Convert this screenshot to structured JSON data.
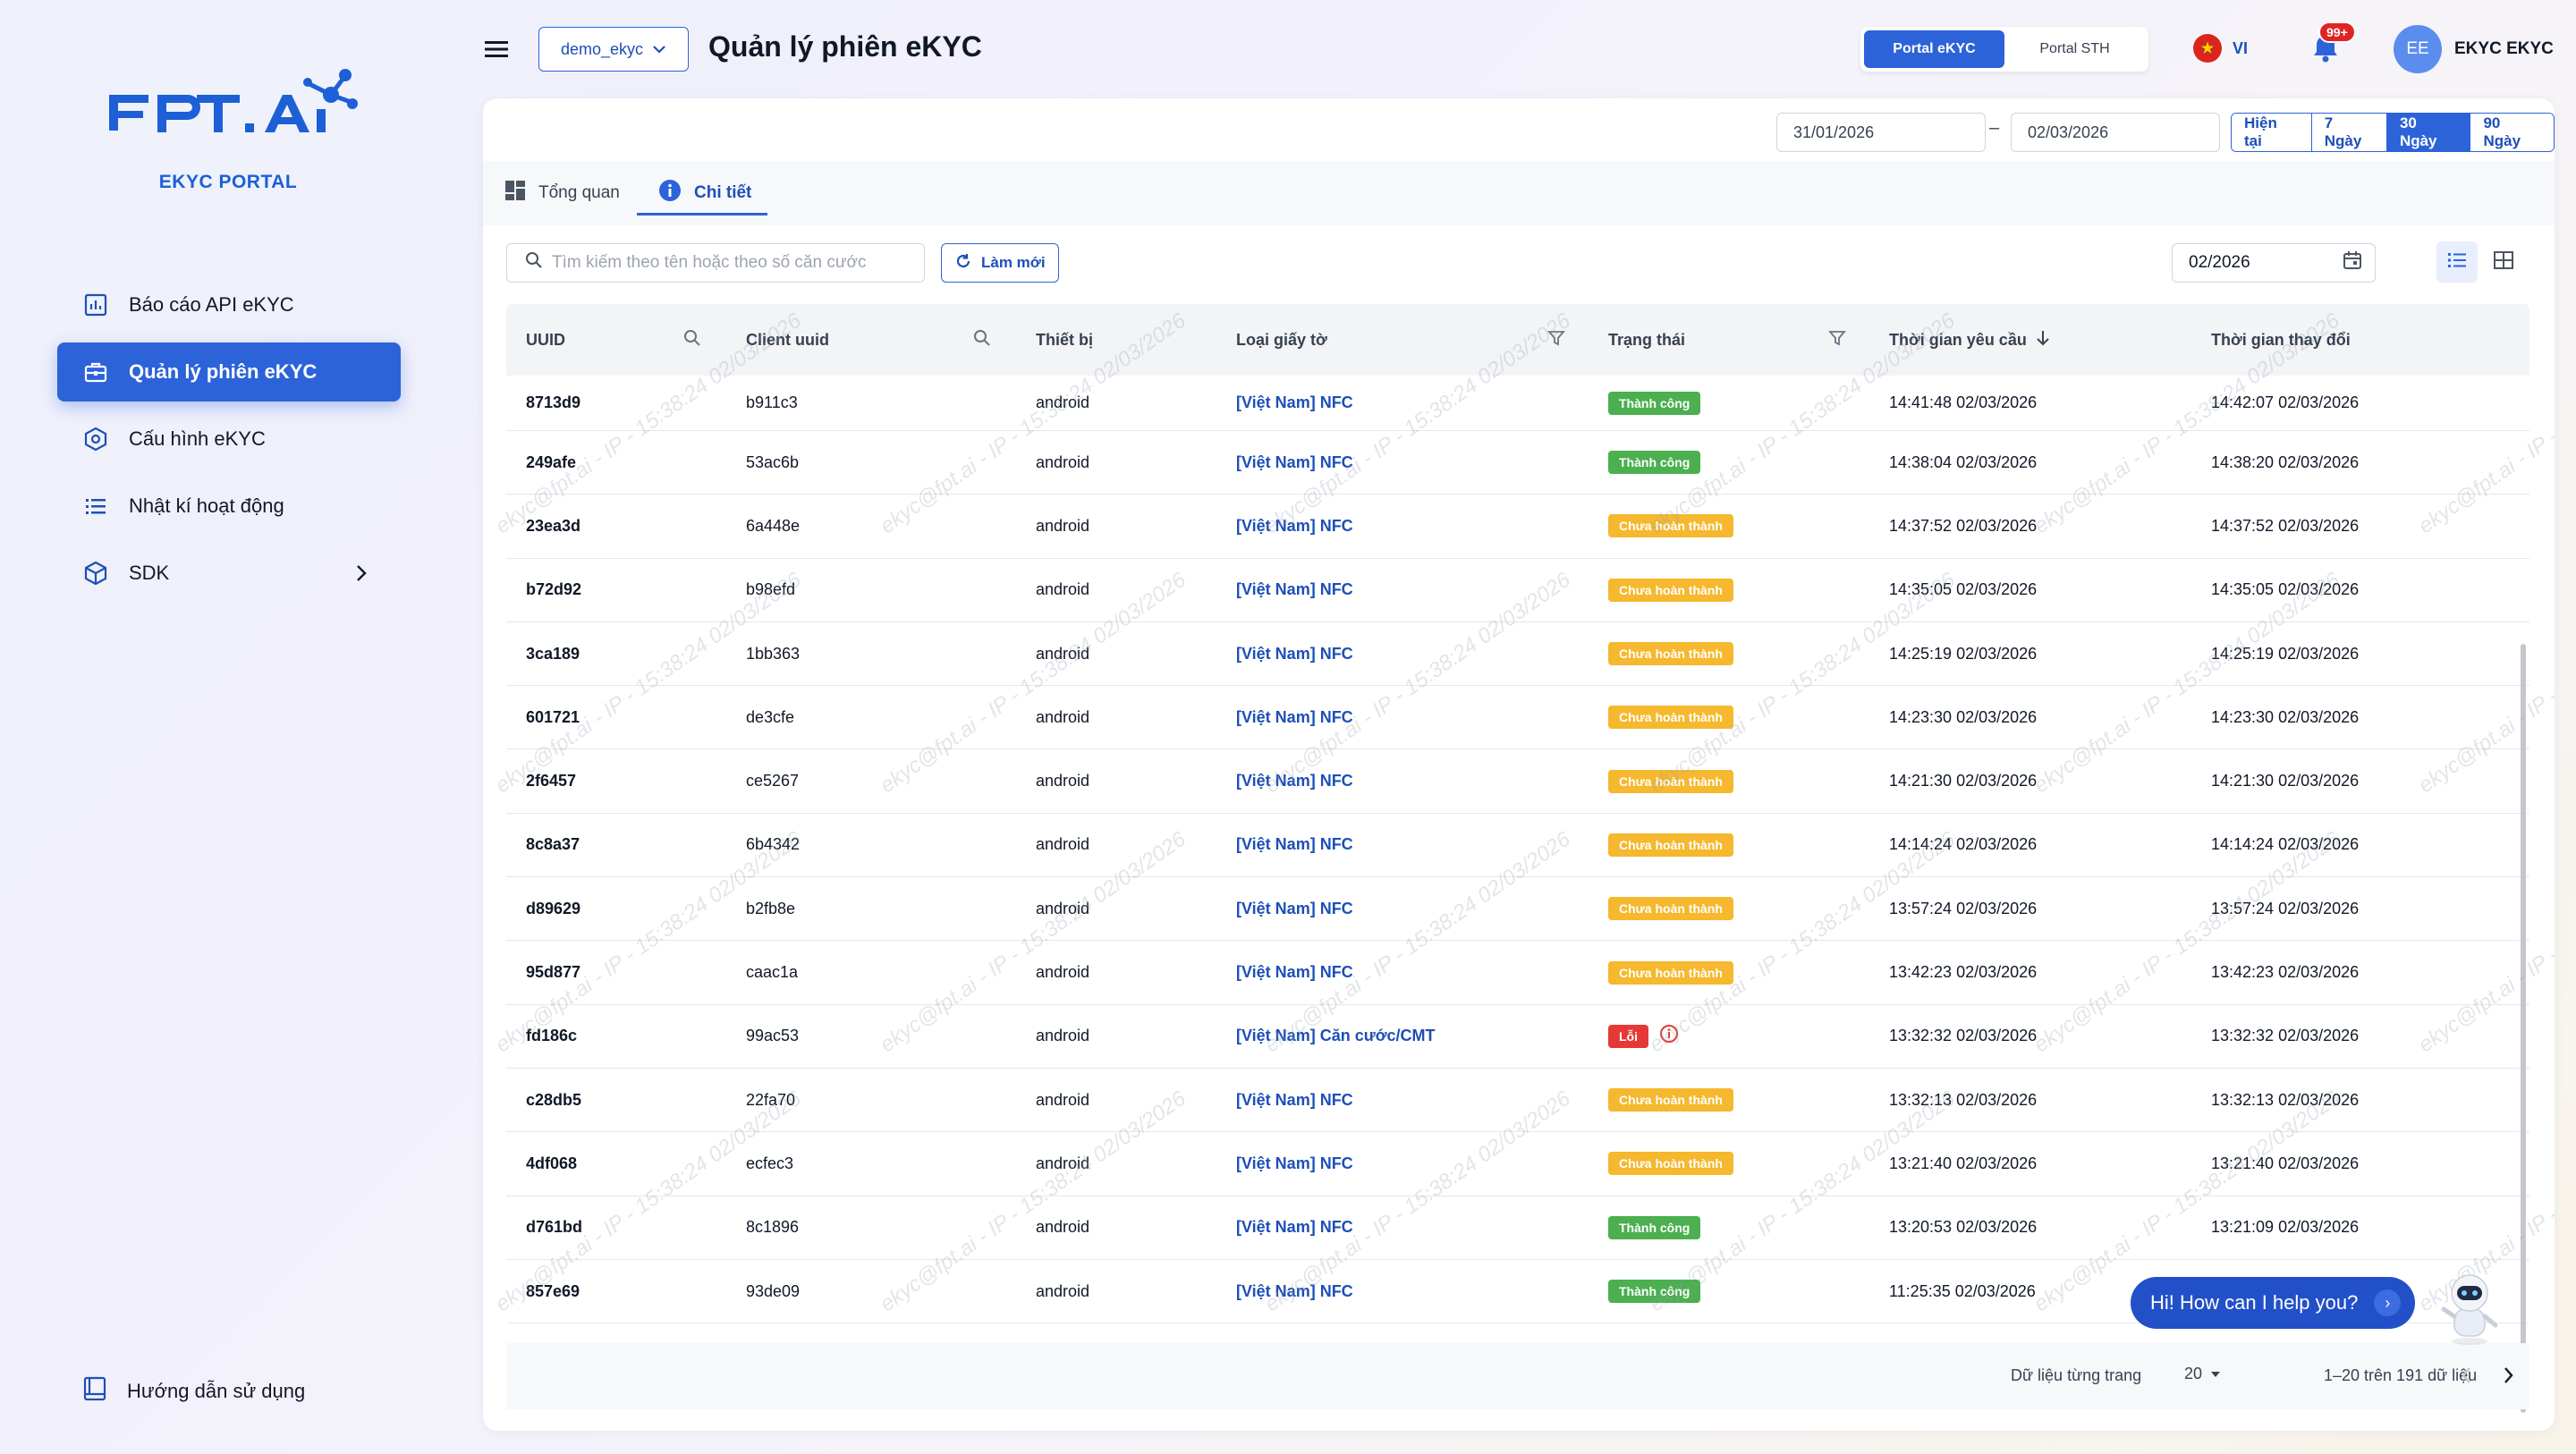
{
  "brand": {
    "logo_text": "FPT.AI",
    "sub": "EKYC PORTAL"
  },
  "sidebar": {
    "items": [
      {
        "label": "Báo cáo API eKYC",
        "icon": "chart-icon"
      },
      {
        "label": "Quản lý phiên eKYC",
        "icon": "briefcase-icon",
        "active": true
      },
      {
        "label": "Cấu hình eKYC",
        "icon": "settings-hex-icon"
      },
      {
        "label": "Nhật kí hoạt động",
        "icon": "list-icon"
      },
      {
        "label": "SDK",
        "icon": "cube-icon"
      }
    ],
    "guide": "Hướng dẫn sử dụng"
  },
  "header": {
    "tenant": "demo_ekyc",
    "title": "Quản lý phiên eKYC",
    "portals": [
      "Portal eKYC",
      "Portal STH"
    ],
    "lang": "VI",
    "notifications": "99+",
    "avatar": "EE",
    "user": "EKYC EKYC"
  },
  "filters": {
    "date_from": "31/01/2026",
    "date_to": "02/03/2026",
    "ranges": [
      "Hiện tại",
      "7 Ngày",
      "30 Ngày",
      "90 Ngày"
    ],
    "active_range": "30 Ngày"
  },
  "tabs": [
    "Tổng quan",
    "Chi tiết"
  ],
  "toolbar": {
    "search_placeholder": "Tìm kiếm theo tên hoặc theo số căn cước",
    "refresh": "Làm mới",
    "month": "02/2026"
  },
  "table": {
    "columns": [
      "UUID",
      "Client uuid",
      "Thiết bị",
      "Loại giấy tờ",
      "Trạng thái",
      "Thời gian yêu cầu",
      "Thời gian thay đổi"
    ],
    "rows": [
      [
        "8713d9",
        "b911c3",
        "android",
        "[Việt Nam] NFC",
        "Thành công",
        "14:41:48 02/03/2026",
        "14:42:07 02/03/2026"
      ],
      [
        "249afe",
        "53ac6b",
        "android",
        "[Việt Nam] NFC",
        "Thành công",
        "14:38:04 02/03/2026",
        "14:38:20 02/03/2026"
      ],
      [
        "23ea3d",
        "6a448e",
        "android",
        "[Việt Nam] NFC",
        "Chưa hoàn thành",
        "14:37:52 02/03/2026",
        "14:37:52 02/03/2026"
      ],
      [
        "b72d92",
        "b98efd",
        "android",
        "[Việt Nam] NFC",
        "Chưa hoàn thành",
        "14:35:05 02/03/2026",
        "14:35:05 02/03/2026"
      ],
      [
        "3ca189",
        "1bb363",
        "android",
        "[Việt Nam] NFC",
        "Chưa hoàn thành",
        "14:25:19 02/03/2026",
        "14:25:19 02/03/2026"
      ],
      [
        "601721",
        "de3cfe",
        "android",
        "[Việt Nam] NFC",
        "Chưa hoàn thành",
        "14:23:30 02/03/2026",
        "14:23:30 02/03/2026"
      ],
      [
        "2f6457",
        "ce5267",
        "android",
        "[Việt Nam] NFC",
        "Chưa hoàn thành",
        "14:21:30 02/03/2026",
        "14:21:30 02/03/2026"
      ],
      [
        "8c8a37",
        "6b4342",
        "android",
        "[Việt Nam] NFC",
        "Chưa hoàn thành",
        "14:14:24 02/03/2026",
        "14:14:24 02/03/2026"
      ],
      [
        "d89629",
        "b2fb8e",
        "android",
        "[Việt Nam] NFC",
        "Chưa hoàn thành",
        "13:57:24 02/03/2026",
        "13:57:24 02/03/2026"
      ],
      [
        "95d877",
        "caac1a",
        "android",
        "[Việt Nam] NFC",
        "Chưa hoàn thành",
        "13:42:23 02/03/2026",
        "13:42:23 02/03/2026"
      ],
      [
        "fd186c",
        "99ac53",
        "android",
        "[Việt Nam] Căn cước/CMT",
        "Lỗi",
        "13:32:32 02/03/2026",
        "13:32:32 02/03/2026"
      ],
      [
        "c28db5",
        "22fa70",
        "android",
        "[Việt Nam] NFC",
        "Chưa hoàn thành",
        "13:32:13 02/03/2026",
        "13:32:13 02/03/2026"
      ],
      [
        "4df068",
        "ecfec3",
        "android",
        "[Việt Nam] NFC",
        "Chưa hoàn thành",
        "13:21:40 02/03/2026",
        "13:21:40 02/03/2026"
      ],
      [
        "d761bd",
        "8c1896",
        "android",
        "[Việt Nam] NFC",
        "Thành công",
        "13:20:53 02/03/2026",
        "13:21:09 02/03/2026"
      ],
      [
        "857e69",
        "93de09",
        "android",
        "[Việt Nam] NFC",
        "Thành công",
        "11:25:35 02/03/2026",
        ""
      ]
    ]
  },
  "pagination": {
    "label": "Dữ liệu từng trang",
    "page_size": "20",
    "range": "1–20 trên 191 dữ liệu"
  },
  "watermark": "ekyc@fpt.ai - IP - 15:38:24 02/03/2026",
  "chat": {
    "text": "Hi! How can I help you?"
  },
  "colors": {
    "primary": "#2d63d9",
    "success": "#4caf50",
    "pending": "#f5b82e",
    "error": "#e53935"
  }
}
